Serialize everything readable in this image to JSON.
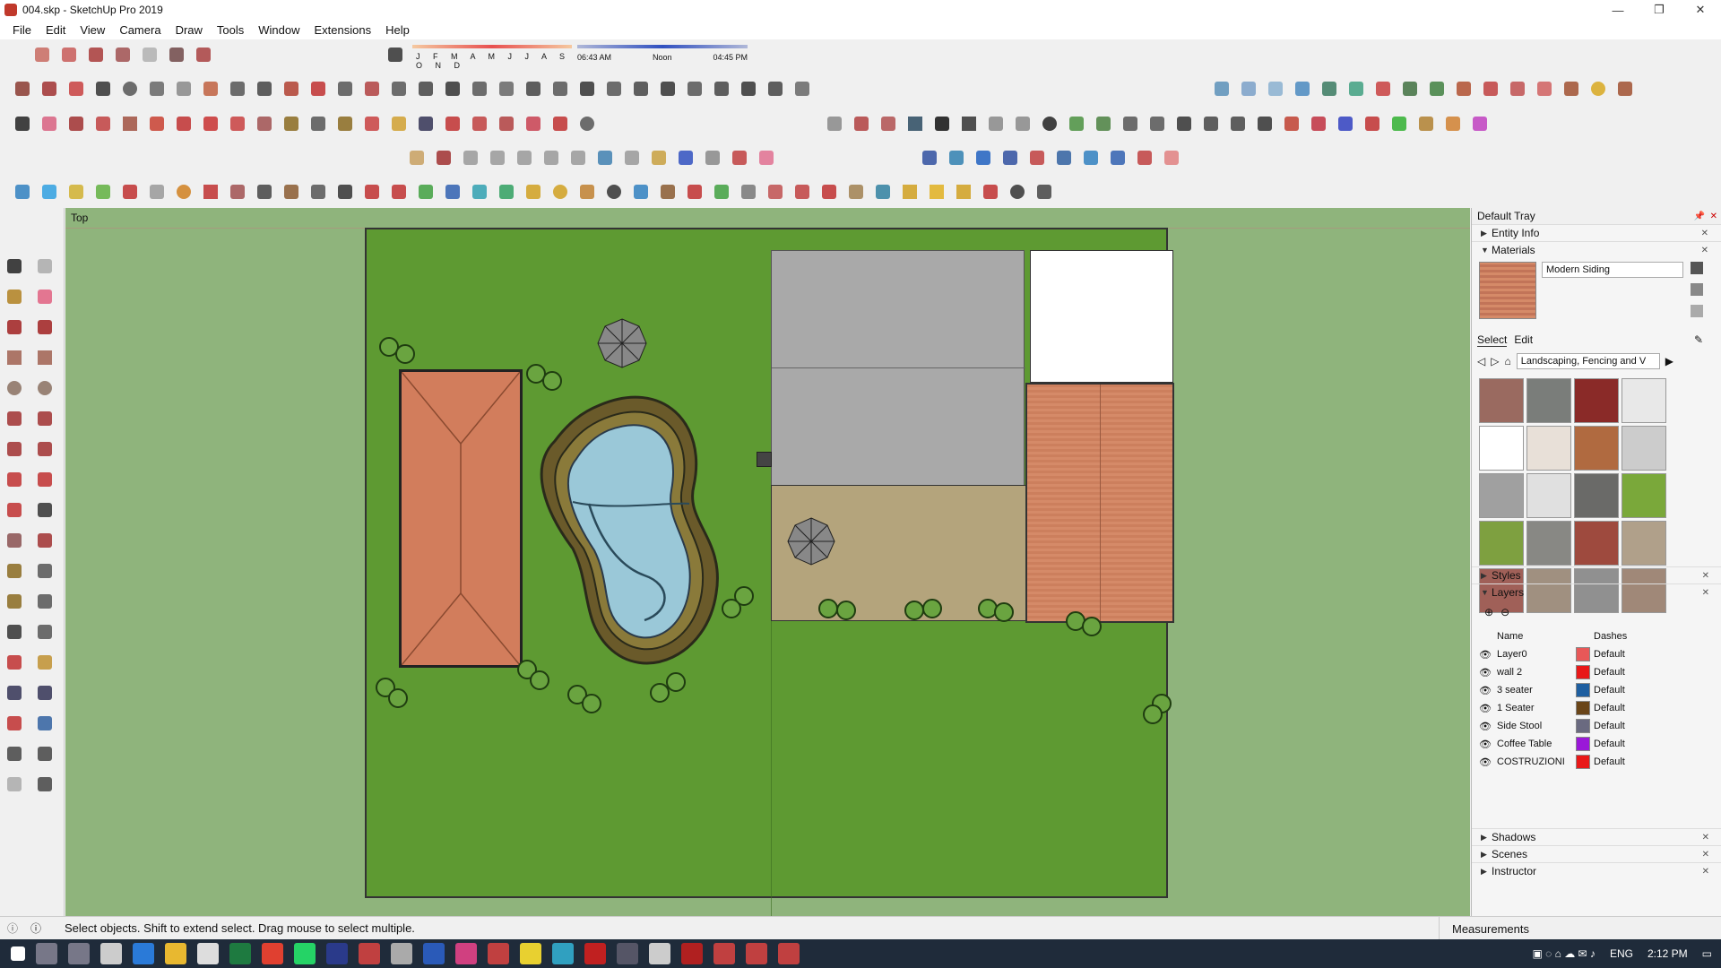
{
  "window": {
    "title": "004.skp - SketchUp Pro 2019",
    "minimize": "—",
    "restore": "❐",
    "close": "✕"
  },
  "menu": [
    "File",
    "Edit",
    "View",
    "Camera",
    "Draw",
    "Tools",
    "Window",
    "Extensions",
    "Help"
  ],
  "shadow_settings": {
    "months": "J F M A M J J A S O N D",
    "time_start": "06:43 AM",
    "time_mid": "Noon",
    "time_end": "04:45 PM"
  },
  "viewport": {
    "view_label": "Top"
  },
  "tray": {
    "title": "Default Tray",
    "sections": {
      "entity_info": "Entity Info",
      "materials": "Materials",
      "styles": "Styles",
      "layers": "Layers",
      "shadows": "Shadows",
      "scenes": "Scenes",
      "instructor": "Instructor"
    },
    "material_name": "Modern Siding",
    "tabs": {
      "select": "Select",
      "edit": "Edit"
    },
    "category": "Landscaping, Fencing and V",
    "swatch_colors": [
      "#9a6a60",
      "#7a7d7a",
      "#8a2a28",
      "#e8e8e8",
      "#ffffff",
      "#e8e0d8",
      "#b06a40",
      "#cccccc",
      "#a0a0a0",
      "#e0e0e0",
      "#6a6a68",
      "#7aa83a",
      "#7ea040",
      "#888884",
      "#9e4a3e",
      "#b0a08a",
      "#a06058",
      "#a09080",
      "#909090",
      "#a08878"
    ],
    "layer_headers": {
      "name": "Name",
      "dashes": "Dashes"
    },
    "layers": [
      {
        "name": "Layer0",
        "color": "#e85858",
        "dashes": "Default"
      },
      {
        "name": "wall 2",
        "color": "#e81818",
        "dashes": "Default"
      },
      {
        "name": "3 seater",
        "color": "#1f5fa0",
        "dashes": "Default"
      },
      {
        "name": "1 Seater",
        "color": "#6a4518",
        "dashes": "Default"
      },
      {
        "name": "Side Stool",
        "color": "#6a6a80",
        "dashes": "Default"
      },
      {
        "name": "Coffee Table",
        "color": "#9a18d8",
        "dashes": "Default"
      },
      {
        "name": "COSTRUZIONI",
        "color": "#e81818",
        "dashes": "Default"
      }
    ]
  },
  "status": {
    "message": "Select objects. Shift to extend select. Drag mouse to select multiple.",
    "measurements": "Measurements"
  },
  "taskbar": {
    "language": "ENG",
    "time": "2:12 PM"
  }
}
